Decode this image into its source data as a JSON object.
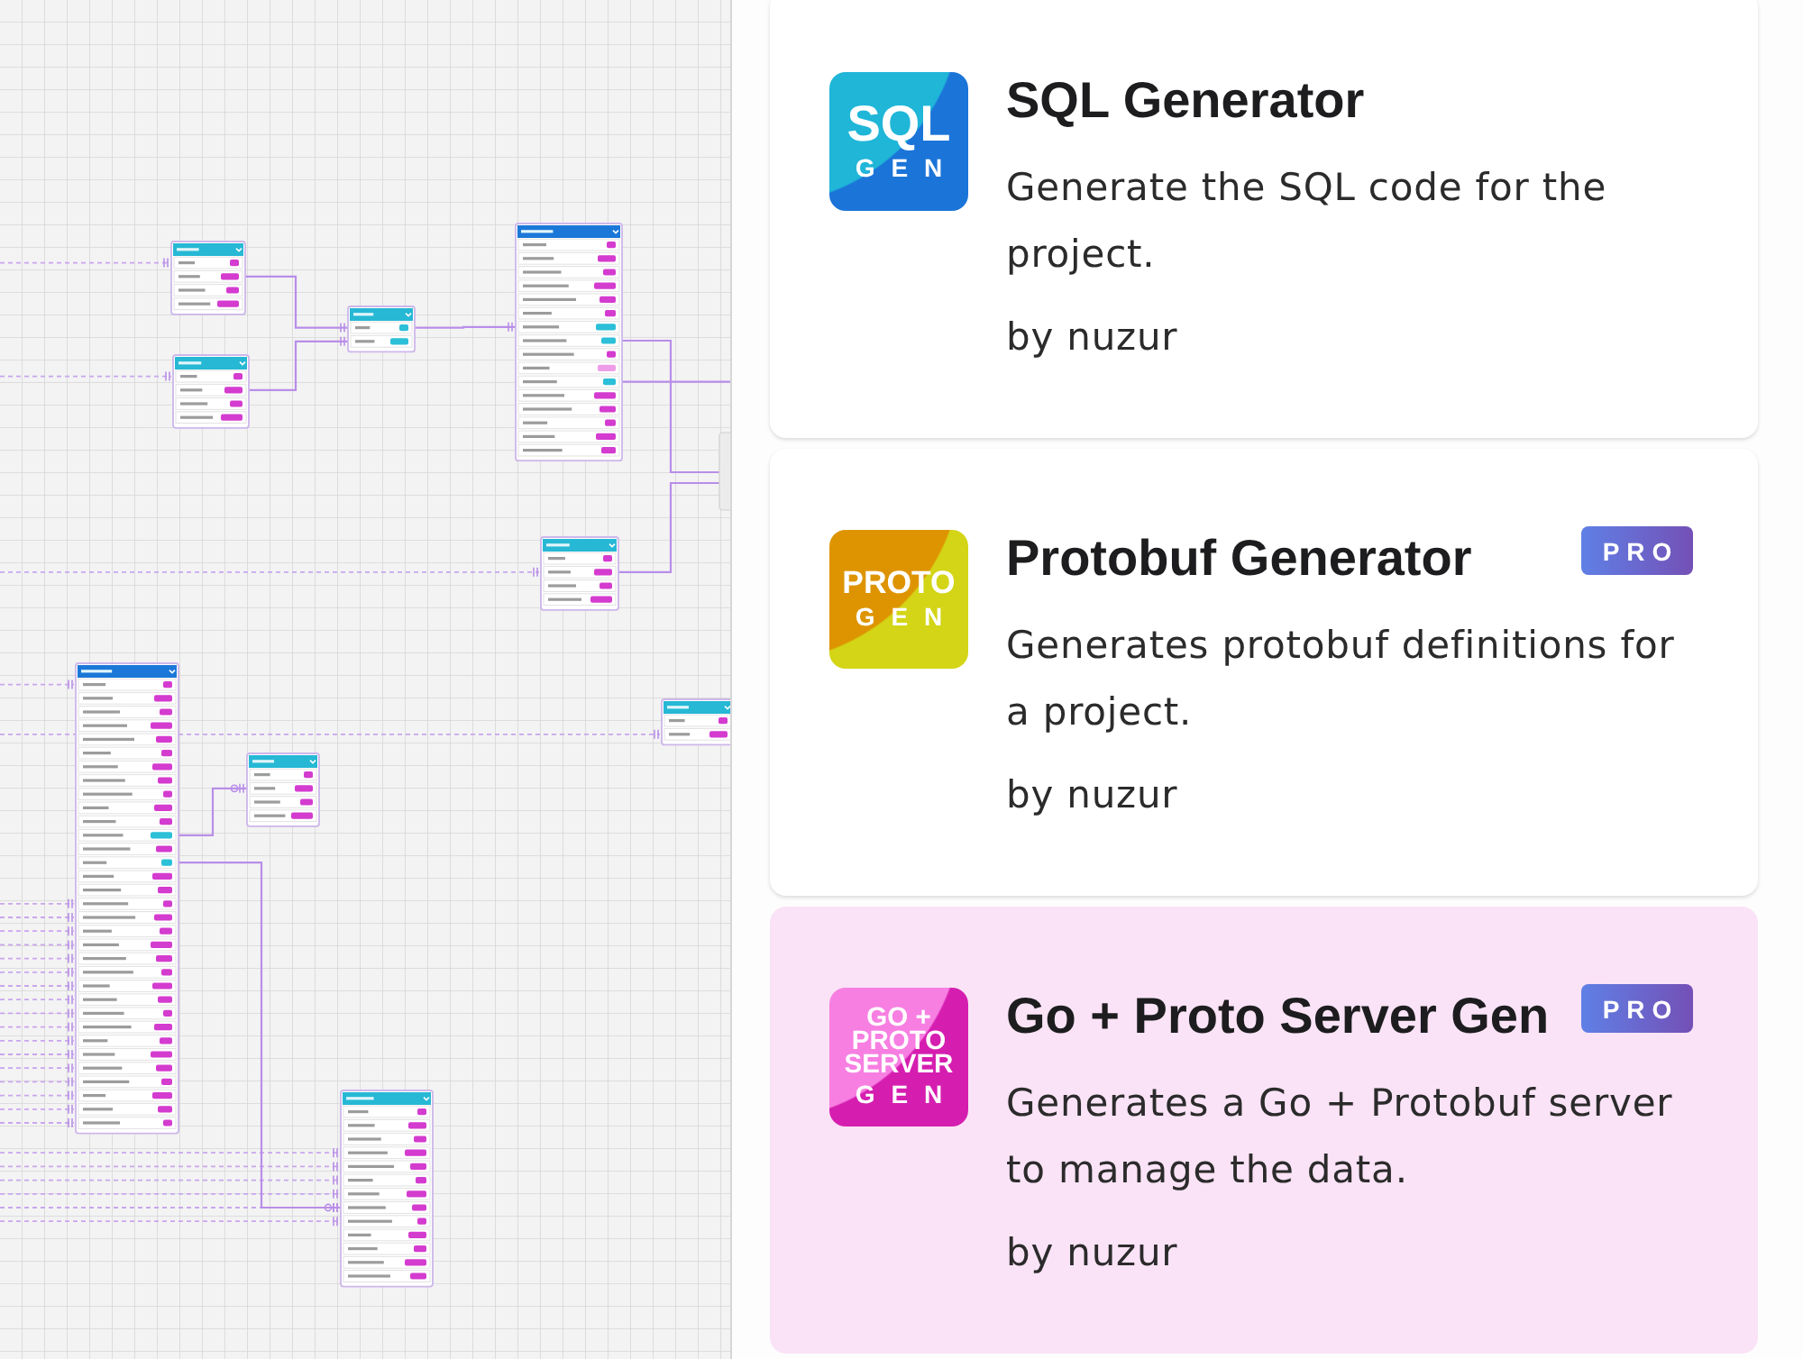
{
  "plugins": [
    {
      "logo": {
        "lines": [
          {
            "text": "SQL",
            "kind": "wordmark"
          },
          {
            "text": "GEN",
            "kind": "spaced"
          }
        ],
        "tones": [
          {
            "color": "#1fb6d8"
          },
          {
            "color": "#1b74d8"
          }
        ]
      },
      "title": "SQL Generator",
      "description": "Generate the SQL code for the project.",
      "author": "by nuzur",
      "selected": false
    },
    {
      "logo": {
        "lines": [
          {
            "text": "PROTO",
            "kind": "wordmark"
          },
          {
            "text": "GEN",
            "kind": "spaced"
          }
        ],
        "tones": [
          {
            "color": "#de9400"
          },
          {
            "color": "#d3d516"
          }
        ]
      },
      "title": "Protobuf Generator",
      "badge": "PRO",
      "description": "Generates protobuf definitions for a project.",
      "author": "by nuzur",
      "selected": false
    },
    {
      "logo": {
        "lines": [
          {
            "text": "GO +",
            "kind": "wordmark"
          },
          {
            "text": "PROTO",
            "kind": "wordmark"
          },
          {
            "text": "SERVER",
            "kind": "wordmark"
          },
          {
            "text": "GEN",
            "kind": "spaced"
          }
        ],
        "tones": [
          {
            "color": "#f77fe2"
          },
          {
            "color": "#d51eb0"
          }
        ]
      },
      "title": "Go + Proto Server Gen",
      "badge": "PRO",
      "description": "Generates a Go + Protobuf server to manage the data.",
      "author": "by nuzur",
      "selected": true
    }
  ]
}
